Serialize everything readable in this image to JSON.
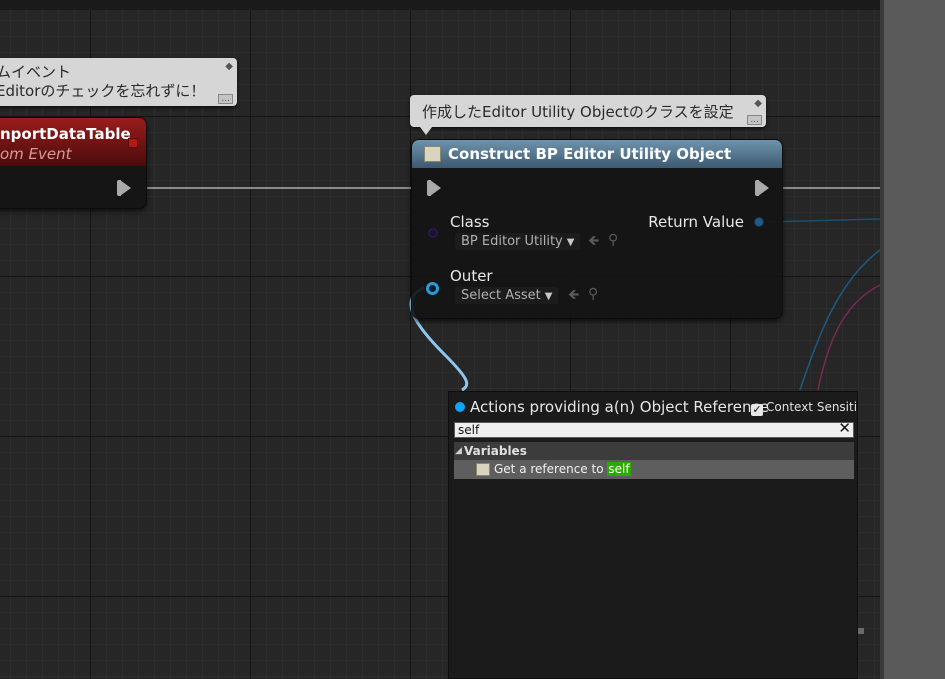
{
  "comments": {
    "left": {
      "line1": "ムイベント",
      "line2": "Editorのチェックを忘れずに！"
    },
    "construct": {
      "text": "作成したEditor Utility Objectのクラスを設定"
    },
    "more_icon": "..."
  },
  "event_node": {
    "title": "nportDataTable",
    "subtitle": "om Event",
    "color": "#7a1212"
  },
  "construct_node": {
    "title": "Construct BP Editor Utility Object",
    "header_color": "#5b7d96",
    "class_label": "Class",
    "class_value": "BP Editor Utility",
    "outer_label": "Outer",
    "outer_value": "Select Asset",
    "return_label": "Return Value"
  },
  "action_menu": {
    "title": "Actions providing a(n) Object Reference",
    "context_label": "Context Sensitive",
    "context_checked": true,
    "search_value": "self",
    "category": "Variables",
    "item_prefix": "Get a reference to ",
    "item_highlight": "self"
  },
  "icons": {
    "pin": "pin-icon",
    "clear": "close-icon",
    "checkbox": "checkmark-icon",
    "back_arrow": "arrow-left-icon",
    "browse": "magnifier-icon",
    "variable": "variable-icon"
  }
}
